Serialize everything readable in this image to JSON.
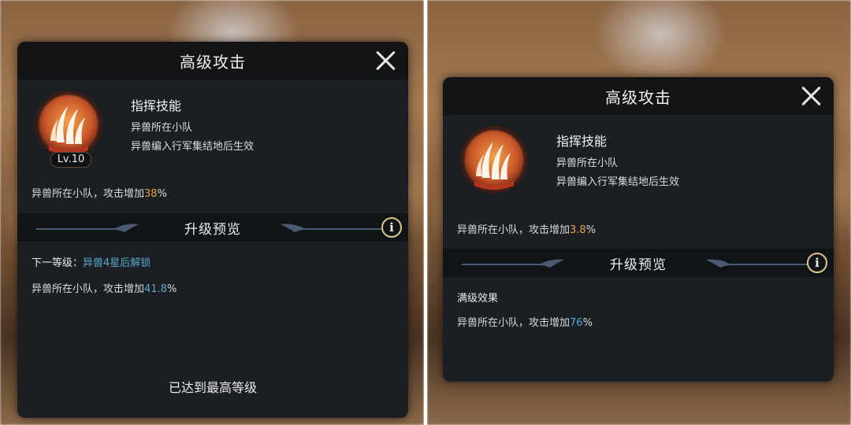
{
  "left": {
    "title": "高级攻击",
    "skill_name": "指挥技能",
    "scope": "异兽所在小队",
    "condition": "异兽编入行军集结地后生效",
    "level": "Lv.10",
    "current_prefix": "异兽所在小队，攻击增加",
    "current_value": "38",
    "current_suffix": "%",
    "preview_title": "升级预览",
    "info_label": "i",
    "next_label": "下一等级：",
    "next_requirement": "异兽4星后解锁",
    "next_prefix": "异兽所在小队，攻击增加",
    "next_value": "41.8",
    "next_suffix": "%",
    "max_level_text": "已达到最高等级"
  },
  "right": {
    "title": "高级攻击",
    "skill_name": "指挥技能",
    "scope": "异兽所在小队",
    "condition": "异兽编入行军集结地后生效",
    "current_prefix": "异兽所在小队，攻击增加",
    "current_value": "3.8",
    "current_suffix": "%",
    "preview_title": "升级预览",
    "info_label": "i",
    "max_effect_label": "满级效果",
    "max_prefix": "异兽所在小队，攻击增加",
    "max_value": "76",
    "max_suffix": "%"
  },
  "colors": {
    "accent_orange": "#e2a24a",
    "accent_blue": "#5aa9c9",
    "panel": "#1b1f24"
  }
}
